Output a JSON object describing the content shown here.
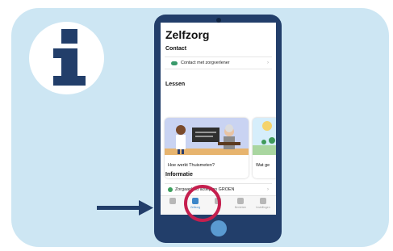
{
  "app": {
    "title": "Zelfzorg",
    "sections": {
      "contact": "Contact",
      "lessen": "Lessen",
      "informatie": "Informatie"
    },
    "contact_row": "Contact met zorgverlener",
    "lessons": [
      {
        "caption": "Hoe werkt Thuismeten?"
      },
      {
        "caption": "Wat ge"
      }
    ],
    "info_row": "Zorgaanbod actieplan GROEN",
    "tabs": [
      {
        "label": "",
        "icon": "home-icon"
      },
      {
        "label": "Zelfzorg",
        "icon": "selfcare-icon",
        "active": true
      },
      {
        "label": "",
        "icon": "chart-icon"
      },
      {
        "label": "Berichten",
        "icon": "chat-icon"
      },
      {
        "label": "Instellingen",
        "icon": "gear-icon"
      }
    ]
  },
  "colors": {
    "panel": "#cde6f3",
    "phone": "#223e6a",
    "highlight_ring": "#c51f4e",
    "accent": "#3c86c9"
  }
}
